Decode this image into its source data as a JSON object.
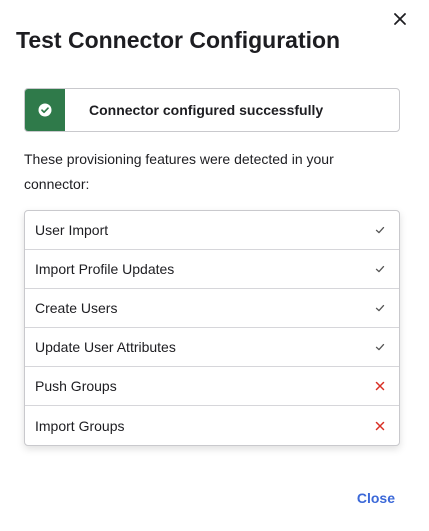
{
  "dialog": {
    "title": "Test Connector Configuration",
    "banner": {
      "message": "Connector configured successfully",
      "status": "success",
      "color": "#2f7a4a"
    },
    "description": "These provisioning features were detected in your connector:",
    "features": [
      {
        "label": "User Import",
        "status": "check-icon"
      },
      {
        "label": "Import Profile Updates",
        "status": "check-icon"
      },
      {
        "label": "Create Users",
        "status": "check-icon"
      },
      {
        "label": "Update User Attributes",
        "status": "check-icon"
      },
      {
        "label": "Push Groups",
        "status": "cross-icon"
      },
      {
        "label": "Import Groups",
        "status": "cross-icon"
      }
    ],
    "close_label": "Close",
    "colors": {
      "success": "#2f7a4a",
      "error": "#d93025",
      "check": "#555555",
      "link": "#3b68d8"
    }
  }
}
